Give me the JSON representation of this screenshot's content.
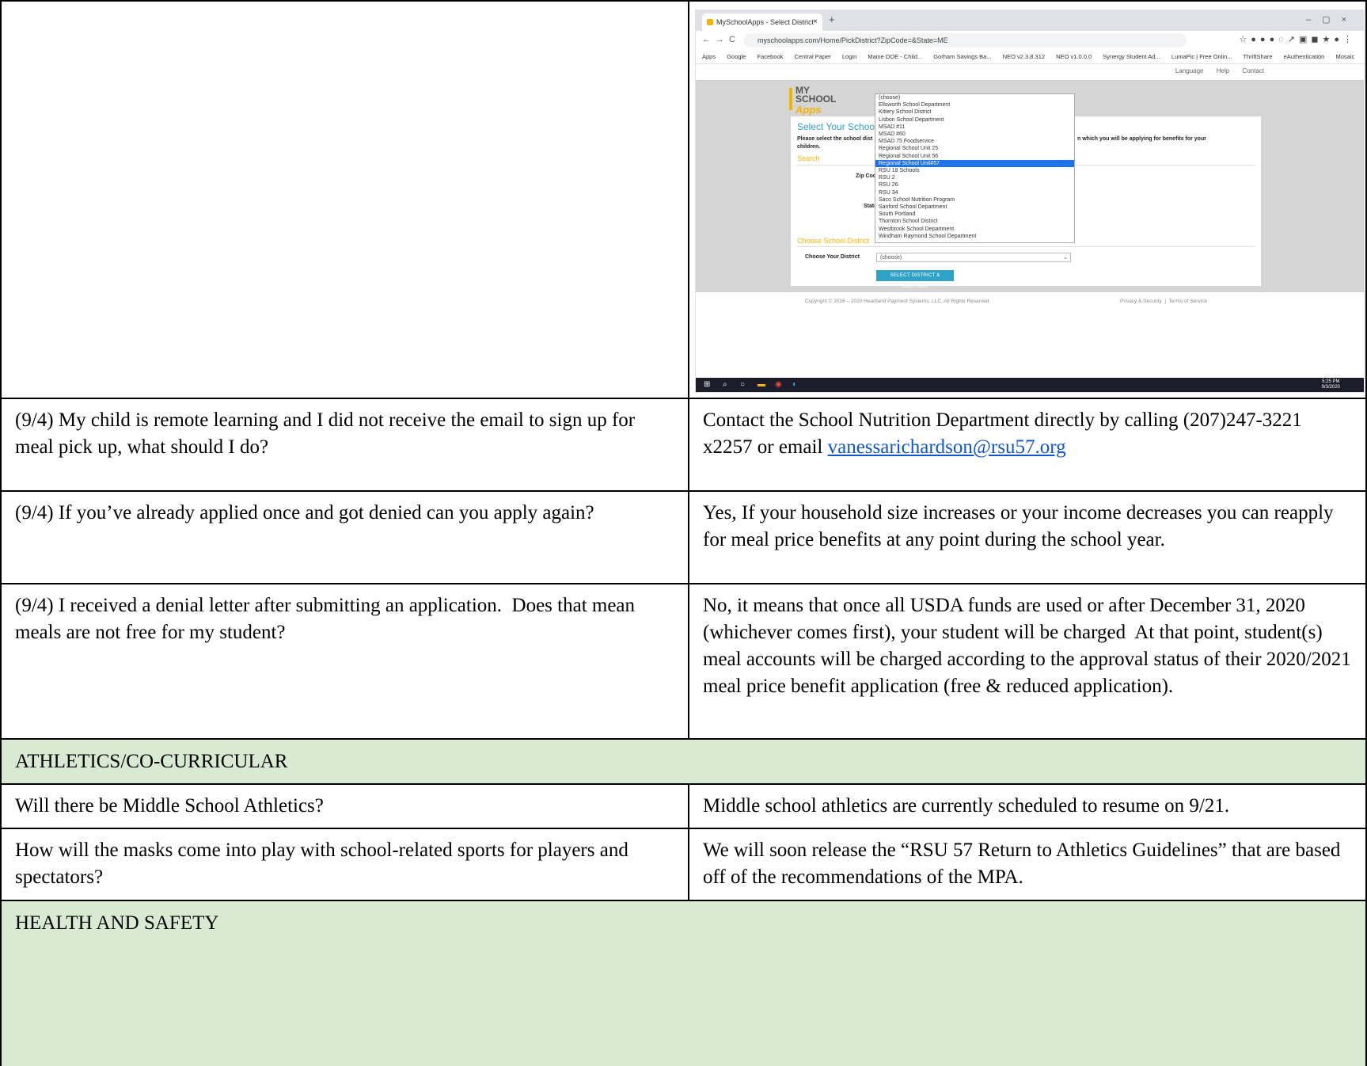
{
  "screenshot": {
    "tab_title": "MySchoolApps - Select District",
    "url": "myschoolapps.com/Home/PickDistrict?ZipCode=&State=ME",
    "bookmarks": [
      "Apps",
      "Google",
      "Facebook",
      "Central Paper",
      "Login",
      "Maine DOE - Child...",
      "Gorham Savings Ba...",
      "NEO v2.3.8.312",
      "NEO v1.0.0.0",
      "Synergy Student Ad...",
      "LumaPic | Free Onlin...",
      "ThriftShare",
      "eAuthentication",
      "Mosaic"
    ],
    "top_links": [
      "Language",
      "Help",
      "Contact"
    ],
    "logo_line1": "MY",
    "logo_line2": "SCHOOL",
    "logo_line3": "Apps",
    "card_heading": "Select Your School",
    "card_text_left": "Please select the school dist",
    "card_text_right": "n which you will be applying for benefits for your",
    "card_text_line2": "children.",
    "search_heading": "Search",
    "zip_label": "Zip Code",
    "state_label": "State",
    "choose_heading": "Choose School District",
    "district_label": "Choose Your District",
    "district_value": "(choose)",
    "continue_button": "SELECT DISTRICT & CONTINUE",
    "copyright": "Copyright © 2016 – 2020 Heartland Payment Systems, LLC. All Rights Reserved.",
    "privacy": "Privacy & Security",
    "terms": "Terms of Service",
    "dropdown_options": [
      "(choose)",
      "Ellsworth School Department",
      "Kittery School District",
      "Lisbon School Department",
      "MSAD #11",
      "MSAD #60",
      "MSAD 75 Foodservice",
      "Regional School Unit 25",
      "Regional School Unit 56",
      "Regional School Unit#57",
      "RSU 18 Schools",
      "RSU 2",
      "RSU 26",
      "RSU 34",
      "Saco School Nutrition Program",
      "Sanford School Department",
      "South Portland",
      "Thornton School District",
      "Westbrook School Department",
      "Windham Raymond School Department"
    ],
    "dropdown_selected_index": 9,
    "clock_time": "5:25 PM",
    "clock_date": "9/3/2020"
  },
  "rows": [
    {
      "question": "(9/4) My child is remote learning and I did not receive the email to sign up for meal pick up, what should I do?",
      "answer_text": "Contact the School Nutrition Department directly by calling (207)247-3221 x2257 or email ",
      "answer_link": "vanessarichardson@rsu57.org"
    },
    {
      "question": "(9/4) If you’ve already applied once and got denied can you apply again?",
      "answer": "Yes, If your household size increases or your income decreases you can reapply for meal price benefits at any point during the school year."
    },
    {
      "question": "(9/4) I received a denial letter after submitting an application.  Does that mean meals are not free for my student?",
      "answer": "No, it means that once all USDA funds are used or after December 31, 2020 (whichever comes first), your student will be charged  At that point, student(s) meal accounts will be charged according to the approval status of their 2020/2021 meal price benefit application (free & reduced application)."
    }
  ],
  "section_athletics": "ATHLETICS/CO-CURRICULAR",
  "athletics_rows": [
    {
      "question": "Will there be Middle School Athletics?",
      "answer": "Middle school athletics are currently scheduled to resume on 9/21."
    },
    {
      "question": "How will the masks come into play with school-related sports for players and spectators?",
      "answer": "We will soon release the “RSU 57 Return to Athletics Guidelines” that are based off of the recommendations of the MPA."
    }
  ],
  "section_health": "HEALTH AND SAFETY"
}
